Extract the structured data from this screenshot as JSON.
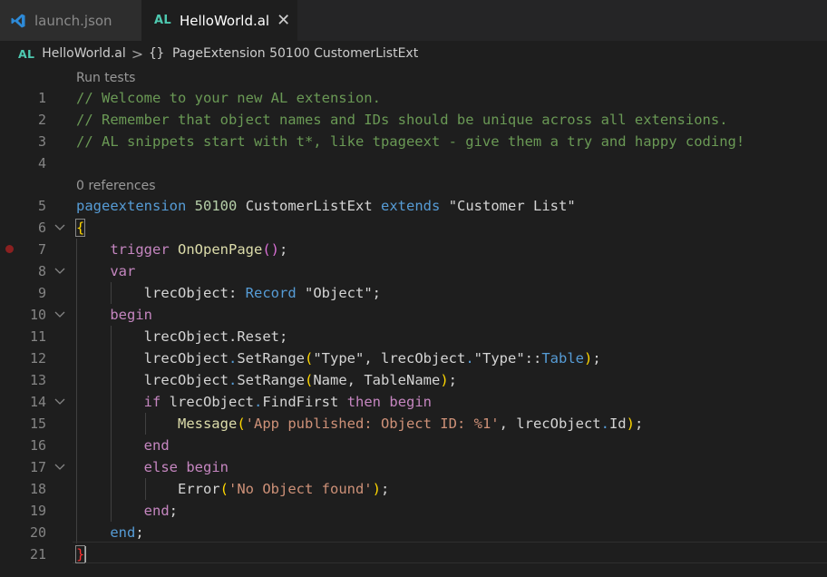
{
  "tabs": [
    {
      "label": "launch.json",
      "icon": "vscode-icon",
      "active": false
    },
    {
      "label": "HelloWorld.al",
      "icon": "al-file-icon",
      "badge": "AL",
      "active": true,
      "close": "✕"
    }
  ],
  "breadcrumb": {
    "badge": "AL",
    "file": "HelloWorld.al",
    "separator": ">",
    "symbol_icon": "{}",
    "symbol": "PageExtension 50100 CustomerListExt"
  },
  "code_lens": {
    "run_tests": "Run tests",
    "references": "0 references"
  },
  "editor": {
    "line_numbers": [
      "1",
      "2",
      "3",
      "4",
      "5",
      "6",
      "7",
      "8",
      "9",
      "10",
      "11",
      "12",
      "13",
      "14",
      "15",
      "16",
      "17",
      "18",
      "19",
      "20",
      "21"
    ],
    "comment1": "// Welcome to your new AL extension.",
    "comment2": "// Remember that object names and IDs should be unique across all extensions.",
    "comment3": "// AL snippets start with t*, like tpageext - give them a try and happy coding!",
    "kw_pageextension": "pageextension",
    "id_50100": "50100",
    "name_customerlistext": "CustomerListExt",
    "kw_extends": "extends",
    "str_customerlist": "\"Customer List\"",
    "brace_open": "{",
    "kw_trigger": "trigger",
    "trigger_name": "OnOpenPage",
    "parens_open": "(",
    "parens_close": ")",
    "semicolon": ";",
    "kw_var": "var",
    "var_lrecobject": "lrecObject",
    "colon": ": ",
    "type_record": "Record",
    "str_object": "\"Object\"",
    "kw_begin": "begin",
    "dot": ".",
    "m_reset": "Reset",
    "m_setrange": "SetRange",
    "str_type": "\"Type\"",
    "comma": ", ",
    "quoted_type": "\"Type\"",
    "scope": "::",
    "enum_table": "Table",
    "arg_name": "Name",
    "arg_tablename": "TableName",
    "kw_if": "if",
    "m_findfirst": "FindFirst",
    "kw_then": "then",
    "fn_message": "Message",
    "str_app_published": "'App published: Object ID: %1'",
    "prop_id": "Id",
    "kw_end": "end",
    "kw_else": "else",
    "fn_error": "Error",
    "str_no_object": "'No Object found'",
    "brace_close": "}"
  },
  "colors": {
    "background": "#1e1e1e",
    "comment": "#6a9955",
    "keyword": "#569cd6",
    "control": "#c586c0",
    "string": "#ce9178",
    "number": "#b5cea8",
    "al_badge": "#4ec9b0",
    "breakpoint": "#8b2020"
  }
}
